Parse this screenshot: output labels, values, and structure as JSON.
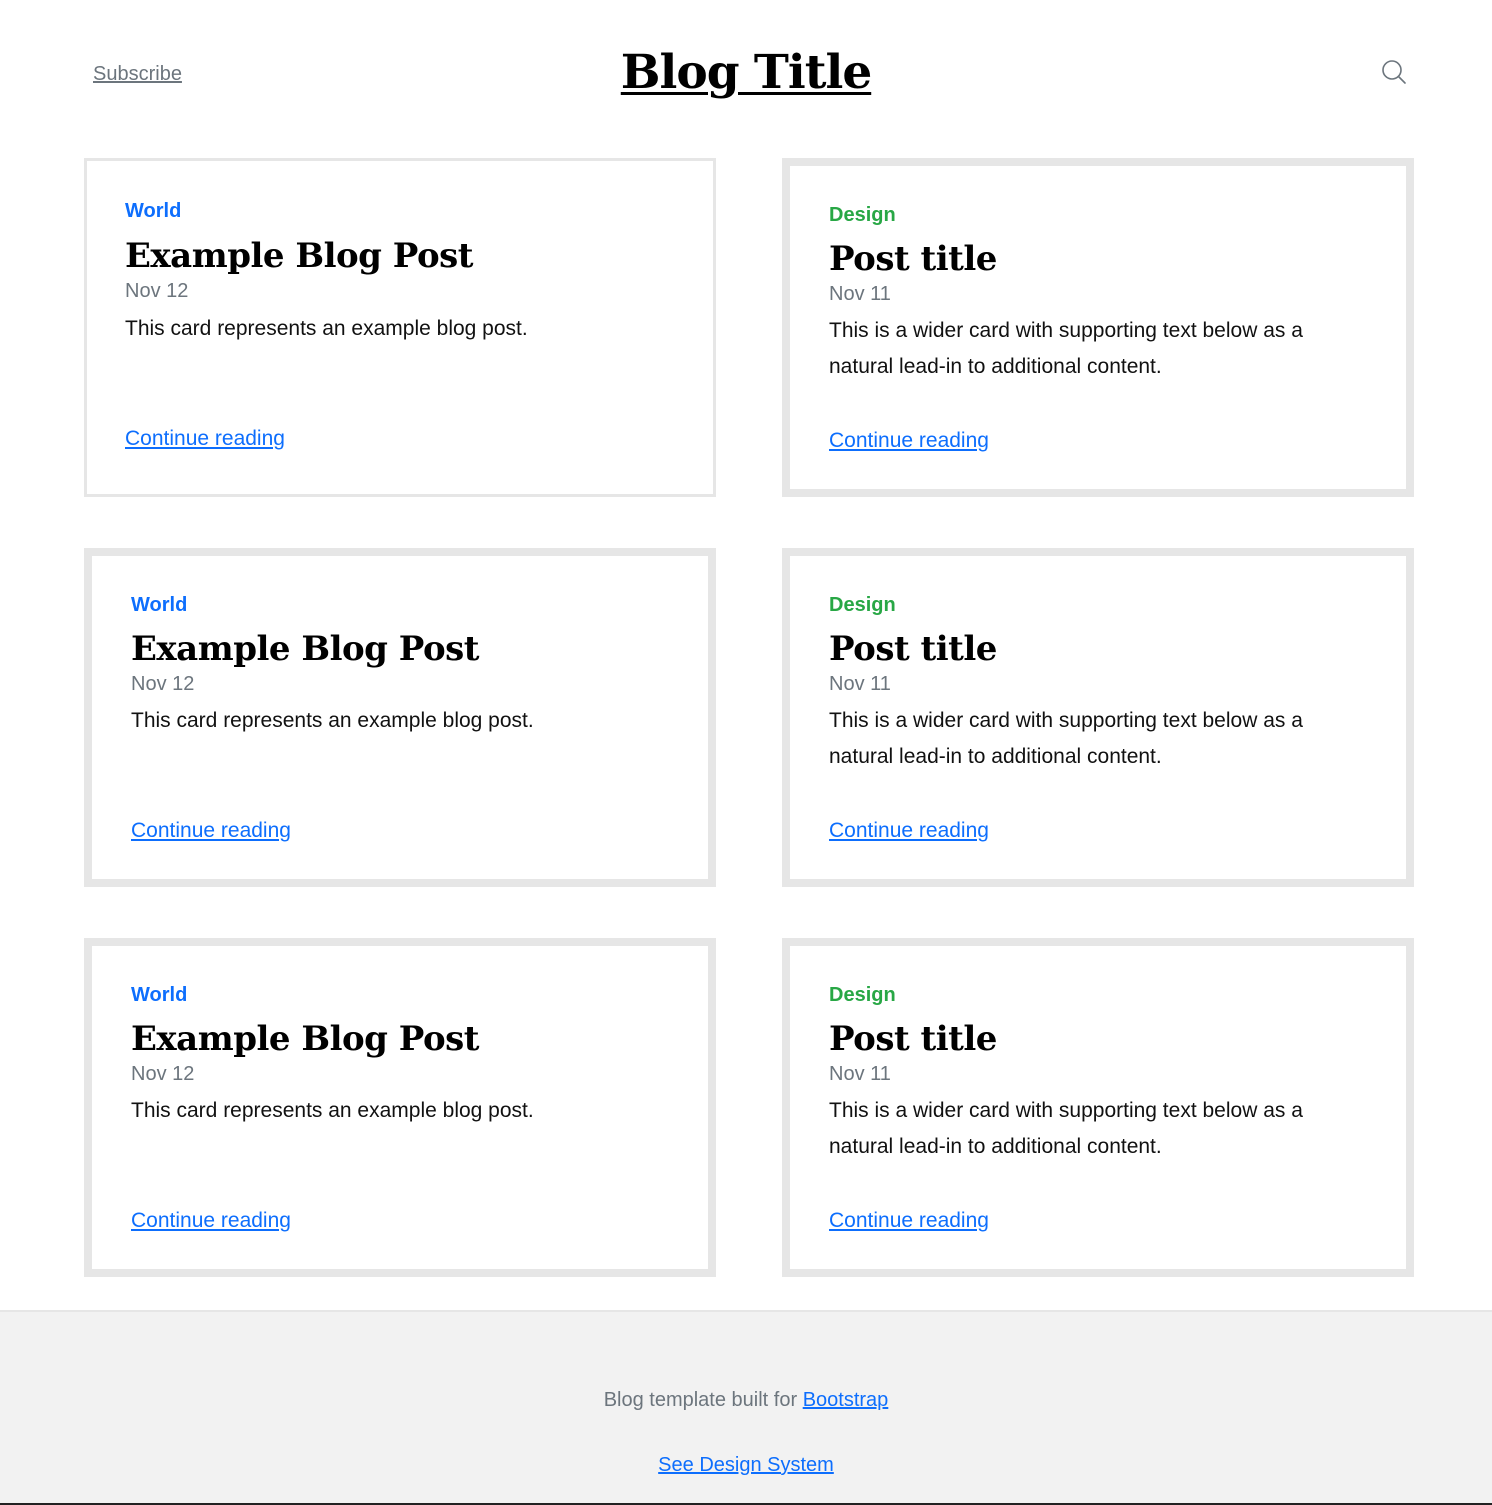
{
  "header": {
    "subscribe_label": "Subscribe",
    "title": "Blog Title",
    "search_icon": "search-icon"
  },
  "cards": [
    {
      "category": "World",
      "title": "Example Blog Post",
      "date": "Nov 12",
      "text": "This card represents an example blog post.",
      "link": "Continue reading"
    },
    {
      "category": "Design",
      "title": "Post title",
      "date": "Nov 11",
      "text": "This is a wider card with supporting text below as a natural lead-in to additional content.",
      "link": "Continue reading"
    },
    {
      "category": "World",
      "title": "Example Blog Post",
      "date": "Nov 12",
      "text": "This card represents an example blog post.",
      "link": "Continue reading"
    },
    {
      "category": "Design",
      "title": "Post title",
      "date": "Nov 11",
      "text": "This is a wider card with supporting text below as a natural lead-in to additional content.",
      "link": "Continue reading"
    },
    {
      "category": "World",
      "title": "Example Blog Post",
      "date": "Nov 12",
      "text": "This card represents an example blog post.",
      "link": "Continue reading"
    },
    {
      "category": "Design",
      "title": "Post title",
      "date": "Nov 11",
      "text": "This is a wider card with supporting text below as a natural lead-in to additional content.",
      "link": "Continue reading"
    }
  ],
  "footer": {
    "text": "Blog template built for",
    "bootstrap_link": "Bootstrap",
    "design_system_link": "See Design System"
  },
  "colors": {
    "world": "#0d6efd",
    "design": "#28a745",
    "link": "#0d6efd",
    "muted": "#6c757d",
    "card_border": "#e6e6e6",
    "footer_bg": "#f2f2f2"
  }
}
